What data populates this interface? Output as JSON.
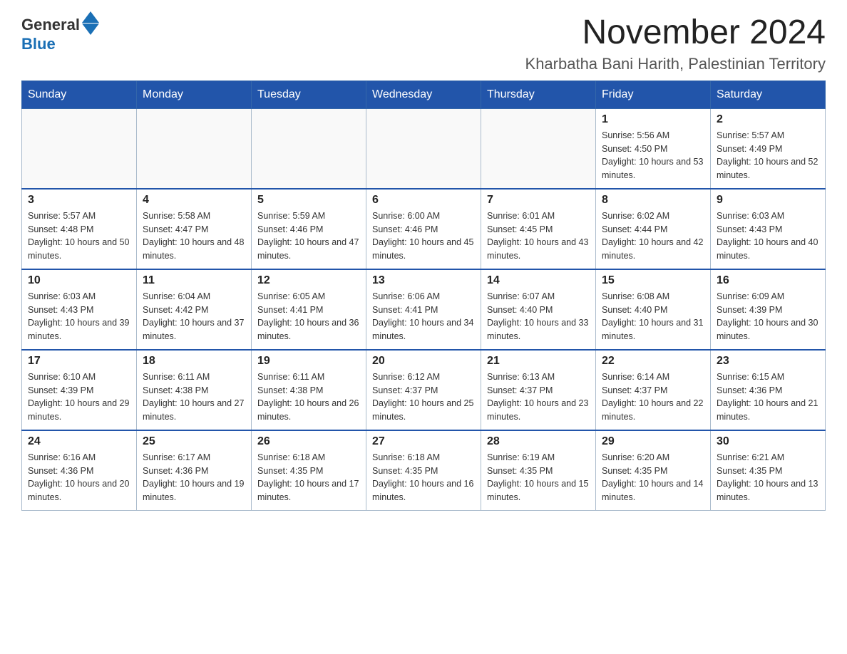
{
  "logo": {
    "general": "General",
    "blue": "Blue"
  },
  "title": "November 2024",
  "location": "Kharbatha Bani Harith, Palestinian Territory",
  "days_header": [
    "Sunday",
    "Monday",
    "Tuesday",
    "Wednesday",
    "Thursday",
    "Friday",
    "Saturday"
  ],
  "weeks": [
    [
      {
        "day": "",
        "sunrise": "",
        "sunset": "",
        "daylight": ""
      },
      {
        "day": "",
        "sunrise": "",
        "sunset": "",
        "daylight": ""
      },
      {
        "day": "",
        "sunrise": "",
        "sunset": "",
        "daylight": ""
      },
      {
        "day": "",
        "sunrise": "",
        "sunset": "",
        "daylight": ""
      },
      {
        "day": "",
        "sunrise": "",
        "sunset": "",
        "daylight": ""
      },
      {
        "day": "1",
        "sunrise": "Sunrise: 5:56 AM",
        "sunset": "Sunset: 4:50 PM",
        "daylight": "Daylight: 10 hours and 53 minutes."
      },
      {
        "day": "2",
        "sunrise": "Sunrise: 5:57 AM",
        "sunset": "Sunset: 4:49 PM",
        "daylight": "Daylight: 10 hours and 52 minutes."
      }
    ],
    [
      {
        "day": "3",
        "sunrise": "Sunrise: 5:57 AM",
        "sunset": "Sunset: 4:48 PM",
        "daylight": "Daylight: 10 hours and 50 minutes."
      },
      {
        "day": "4",
        "sunrise": "Sunrise: 5:58 AM",
        "sunset": "Sunset: 4:47 PM",
        "daylight": "Daylight: 10 hours and 48 minutes."
      },
      {
        "day": "5",
        "sunrise": "Sunrise: 5:59 AM",
        "sunset": "Sunset: 4:46 PM",
        "daylight": "Daylight: 10 hours and 47 minutes."
      },
      {
        "day": "6",
        "sunrise": "Sunrise: 6:00 AM",
        "sunset": "Sunset: 4:46 PM",
        "daylight": "Daylight: 10 hours and 45 minutes."
      },
      {
        "day": "7",
        "sunrise": "Sunrise: 6:01 AM",
        "sunset": "Sunset: 4:45 PM",
        "daylight": "Daylight: 10 hours and 43 minutes."
      },
      {
        "day": "8",
        "sunrise": "Sunrise: 6:02 AM",
        "sunset": "Sunset: 4:44 PM",
        "daylight": "Daylight: 10 hours and 42 minutes."
      },
      {
        "day": "9",
        "sunrise": "Sunrise: 6:03 AM",
        "sunset": "Sunset: 4:43 PM",
        "daylight": "Daylight: 10 hours and 40 minutes."
      }
    ],
    [
      {
        "day": "10",
        "sunrise": "Sunrise: 6:03 AM",
        "sunset": "Sunset: 4:43 PM",
        "daylight": "Daylight: 10 hours and 39 minutes."
      },
      {
        "day": "11",
        "sunrise": "Sunrise: 6:04 AM",
        "sunset": "Sunset: 4:42 PM",
        "daylight": "Daylight: 10 hours and 37 minutes."
      },
      {
        "day": "12",
        "sunrise": "Sunrise: 6:05 AM",
        "sunset": "Sunset: 4:41 PM",
        "daylight": "Daylight: 10 hours and 36 minutes."
      },
      {
        "day": "13",
        "sunrise": "Sunrise: 6:06 AM",
        "sunset": "Sunset: 4:41 PM",
        "daylight": "Daylight: 10 hours and 34 minutes."
      },
      {
        "day": "14",
        "sunrise": "Sunrise: 6:07 AM",
        "sunset": "Sunset: 4:40 PM",
        "daylight": "Daylight: 10 hours and 33 minutes."
      },
      {
        "day": "15",
        "sunrise": "Sunrise: 6:08 AM",
        "sunset": "Sunset: 4:40 PM",
        "daylight": "Daylight: 10 hours and 31 minutes."
      },
      {
        "day": "16",
        "sunrise": "Sunrise: 6:09 AM",
        "sunset": "Sunset: 4:39 PM",
        "daylight": "Daylight: 10 hours and 30 minutes."
      }
    ],
    [
      {
        "day": "17",
        "sunrise": "Sunrise: 6:10 AM",
        "sunset": "Sunset: 4:39 PM",
        "daylight": "Daylight: 10 hours and 29 minutes."
      },
      {
        "day": "18",
        "sunrise": "Sunrise: 6:11 AM",
        "sunset": "Sunset: 4:38 PM",
        "daylight": "Daylight: 10 hours and 27 minutes."
      },
      {
        "day": "19",
        "sunrise": "Sunrise: 6:11 AM",
        "sunset": "Sunset: 4:38 PM",
        "daylight": "Daylight: 10 hours and 26 minutes."
      },
      {
        "day": "20",
        "sunrise": "Sunrise: 6:12 AM",
        "sunset": "Sunset: 4:37 PM",
        "daylight": "Daylight: 10 hours and 25 minutes."
      },
      {
        "day": "21",
        "sunrise": "Sunrise: 6:13 AM",
        "sunset": "Sunset: 4:37 PM",
        "daylight": "Daylight: 10 hours and 23 minutes."
      },
      {
        "day": "22",
        "sunrise": "Sunrise: 6:14 AM",
        "sunset": "Sunset: 4:37 PM",
        "daylight": "Daylight: 10 hours and 22 minutes."
      },
      {
        "day": "23",
        "sunrise": "Sunrise: 6:15 AM",
        "sunset": "Sunset: 4:36 PM",
        "daylight": "Daylight: 10 hours and 21 minutes."
      }
    ],
    [
      {
        "day": "24",
        "sunrise": "Sunrise: 6:16 AM",
        "sunset": "Sunset: 4:36 PM",
        "daylight": "Daylight: 10 hours and 20 minutes."
      },
      {
        "day": "25",
        "sunrise": "Sunrise: 6:17 AM",
        "sunset": "Sunset: 4:36 PM",
        "daylight": "Daylight: 10 hours and 19 minutes."
      },
      {
        "day": "26",
        "sunrise": "Sunrise: 6:18 AM",
        "sunset": "Sunset: 4:35 PM",
        "daylight": "Daylight: 10 hours and 17 minutes."
      },
      {
        "day": "27",
        "sunrise": "Sunrise: 6:18 AM",
        "sunset": "Sunset: 4:35 PM",
        "daylight": "Daylight: 10 hours and 16 minutes."
      },
      {
        "day": "28",
        "sunrise": "Sunrise: 6:19 AM",
        "sunset": "Sunset: 4:35 PM",
        "daylight": "Daylight: 10 hours and 15 minutes."
      },
      {
        "day": "29",
        "sunrise": "Sunrise: 6:20 AM",
        "sunset": "Sunset: 4:35 PM",
        "daylight": "Daylight: 10 hours and 14 minutes."
      },
      {
        "day": "30",
        "sunrise": "Sunrise: 6:21 AM",
        "sunset": "Sunset: 4:35 PM",
        "daylight": "Daylight: 10 hours and 13 minutes."
      }
    ]
  ]
}
